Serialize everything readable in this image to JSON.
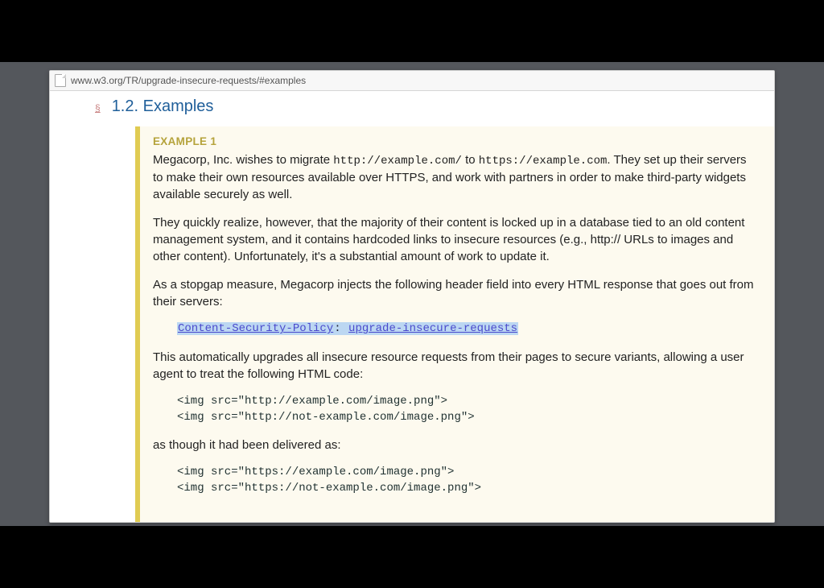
{
  "browser": {
    "url": "www.w3.org/TR/upgrade-insecure-requests/#examples"
  },
  "section": {
    "marker": "§",
    "number_and_title": "1.2. Examples"
  },
  "example": {
    "label": "EXAMPLE 1",
    "p1_a": "Megacorp, Inc. wishes to migrate ",
    "p1_code1": "http://example.com/",
    "p1_b": " to ",
    "p1_code2": "https://example.com",
    "p1_c": ". They set up their servers to make their own resources available over HTTPS, and work with partners in order to make third-party widgets available securely as well.",
    "p2": "They quickly realize, however, that the majority of their content is locked up in a database tied to an old content management system, and it contains hardcoded links to insecure resources (e.g., http:// URLs to images and other content). Unfortunately, it's a substantial amount of work to update it.",
    "p3": "As a stopgap measure, Megacorp injects the following header field into every HTML response that goes out from their servers:",
    "header_link": "Content-Security-Policy",
    "header_sep": ": ",
    "header_value": "upgrade-insecure-requests",
    "p4": "This automatically upgrades all insecure resource requests from their pages to secure variants, allowing a user agent to treat the following HTML code:",
    "code_before": "<img src=\"http://example.com/image.png\">\n<img src=\"http://not-example.com/image.png\">",
    "p5": "as though it had been delivered as:",
    "code_after": "<img src=\"https://example.com/image.png\">\n<img src=\"https://not-example.com/image.png\">"
  }
}
